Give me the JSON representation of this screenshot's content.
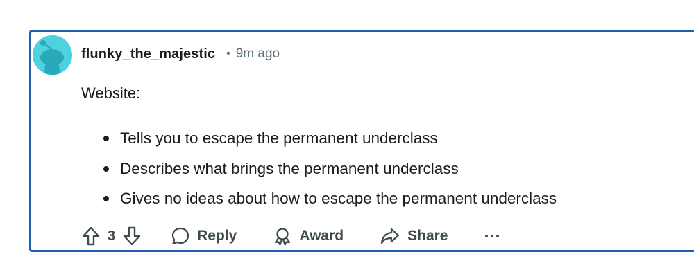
{
  "comment": {
    "username": "flunky_the_majestic",
    "separator": "•",
    "timestamp": "9m ago",
    "body_intro": "Website:",
    "bullets": [
      "Tells you to escape the permanent underclass",
      "Describes what brings the permanent underclass",
      "Gives no ideas about how to escape the permanent underclass"
    ],
    "vote_count": "3",
    "actions": {
      "reply": "Reply",
      "award": "Award",
      "share": "Share",
      "more": "···"
    }
  },
  "colors": {
    "card_border": "#1a5fb4",
    "avatar_bg": "#4fd2e0",
    "avatar_figure": "#2aa9b8",
    "text_primary": "#1c1c1c",
    "text_muted": "#576f76",
    "action_text": "#3f4a4f"
  },
  "icons": {
    "avatar": "snoo-avatar-icon",
    "upvote": "upvote-arrow-icon",
    "downvote": "downvote-arrow-icon",
    "reply": "speech-bubble-icon",
    "award": "award-ribbon-icon",
    "share": "share-arrow-icon",
    "more": "overflow-dots-icon"
  }
}
